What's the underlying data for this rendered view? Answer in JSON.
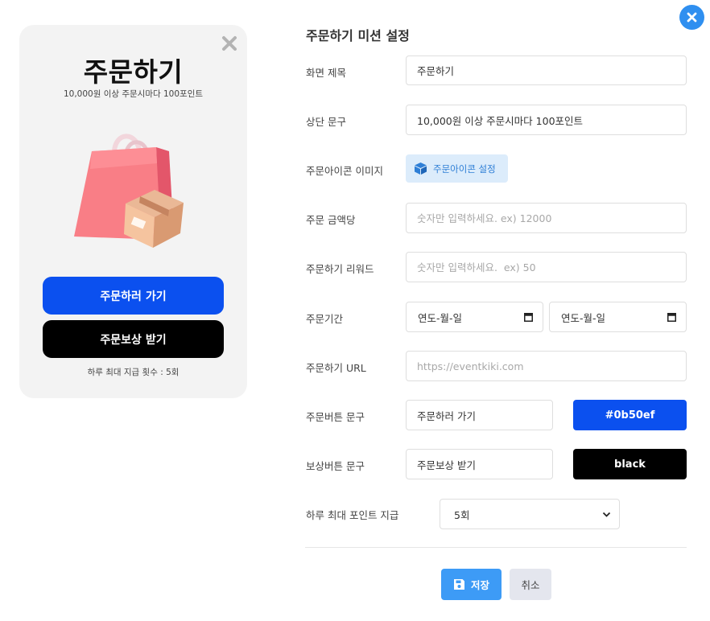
{
  "colors": {
    "accent": "#2f8ff0",
    "primary_button": "#0b50ef",
    "secondary_button": "#000000"
  },
  "preview": {
    "title": "주문하기",
    "subtitle": "10,000원 이상 주문시마다 100포인트",
    "primary_button": "주문하러 가기",
    "secondary_button": "주문보상 받기",
    "daily_note": "하루 최대 지급 횟수 : 5회"
  },
  "form": {
    "heading": "주문하기 미션 설정",
    "screen_title": {
      "label": "화면 제목",
      "value": "주문하기"
    },
    "top_text": {
      "label": "상단 문구",
      "value": "10,000원 이상 주문시마다 100포인트"
    },
    "icon_image": {
      "label": "주문아이콘 이미지",
      "button": "주문아이콘 설정"
    },
    "amount": {
      "label": "주문 금액당",
      "placeholder": "숫자만 입력하세요. ex) 12000"
    },
    "reward": {
      "label": "주문하기 리워드",
      "placeholder": "숫자만 입력하세요.  ex) 50"
    },
    "period": {
      "label": "주문기간",
      "start": "연도-월-일",
      "end": "연도-월-일"
    },
    "url": {
      "label": "주문하기 URL",
      "placeholder": "https://eventkiki.com"
    },
    "order_button": {
      "label": "주문버튼 문구",
      "value": "주문하러 가기",
      "color": "#0b50ef"
    },
    "reward_button": {
      "label": "보상버튼 문구",
      "value": "주문보상 받기",
      "color": "black"
    },
    "daily_limit": {
      "label": "하루 최대 포인트 지급",
      "selected": "5회"
    },
    "save": "저장",
    "cancel": "취소"
  }
}
